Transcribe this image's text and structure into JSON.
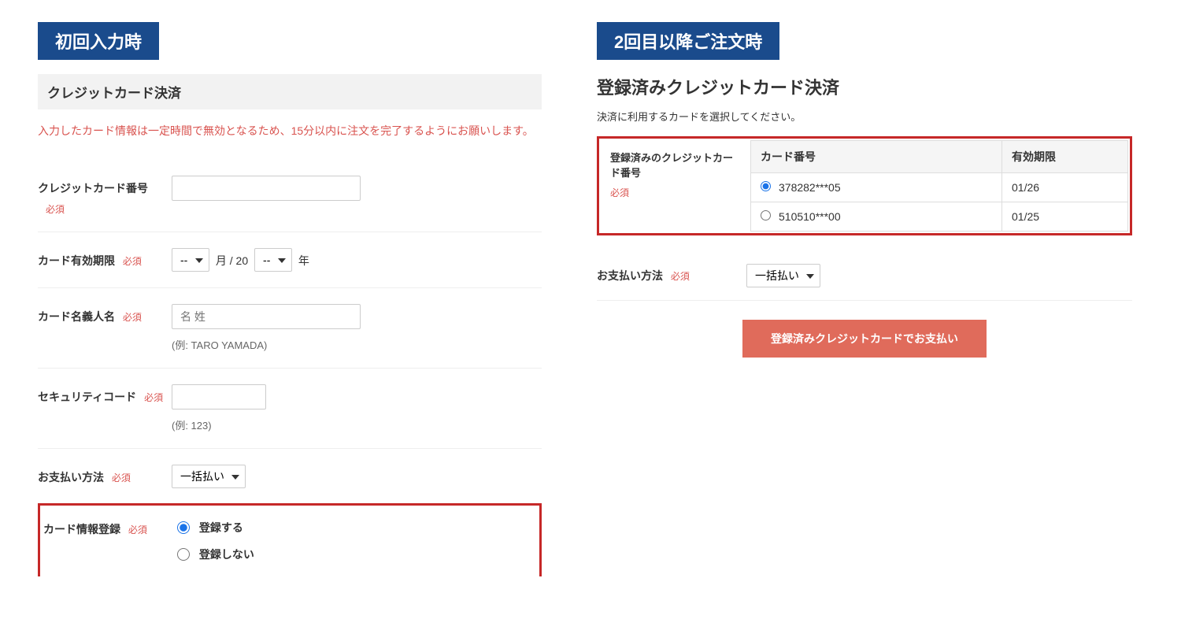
{
  "left": {
    "badge": "初回入力時",
    "header": "クレジットカード決済",
    "notice": "入力したカード情報は一定時間で無効となるため、15分以内に注文を完了するようにお願いします。",
    "required": "必須",
    "card_number_label": "クレジットカード番号",
    "expiry_label": "カード有効期限",
    "expiry_month_placeholder": "--",
    "expiry_year_placeholder": "--",
    "expiry_month_suffix": "月 / 20",
    "expiry_year_suffix": "年",
    "holder_label": "カード名義人名",
    "holder_placeholder": "名 姓",
    "holder_hint": "(例: TARO YAMADA)",
    "cvv_label": "セキュリティコード",
    "cvv_hint": "(例: 123)",
    "pay_method_label": "お支払い方法",
    "pay_method_value": "一括払い",
    "save_label": "カード情報登録",
    "save_yes": "登録する",
    "save_no": "登録しない"
  },
  "right": {
    "badge": "2回目以降ご注文時",
    "title": "登録済みクレジットカード決済",
    "subtext": "決済に利用するカードを選択してください。",
    "saved_label": "登録済みのクレジットカード番号",
    "required": "必須",
    "th_card": "カード番号",
    "th_exp": "有効期限",
    "cards": [
      {
        "num": "378282***05",
        "exp": "01/26",
        "checked": true
      },
      {
        "num": "510510***00",
        "exp": "01/25",
        "checked": false
      }
    ],
    "pay_method_label": "お支払い方法",
    "pay_method_value": "一括払い",
    "button": "登録済みクレジットカードでお支払い"
  }
}
